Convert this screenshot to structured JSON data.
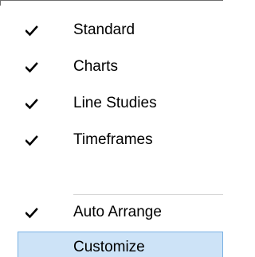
{
  "menu": {
    "items": [
      {
        "label": "Standard",
        "checked": true,
        "icon": "check-icon"
      },
      {
        "label": "Charts",
        "checked": true,
        "icon": "check-icon"
      },
      {
        "label": "Line Studies",
        "checked": true,
        "icon": "check-icon"
      },
      {
        "label": "Timeframes",
        "checked": true,
        "icon": "check-icon"
      },
      {
        "label": "Auto Arrange",
        "checked": true,
        "icon": "check-icon"
      },
      {
        "label": "Customize",
        "checked": false,
        "highlighted": true
      }
    ]
  },
  "colors": {
    "highlight_background": "#cde3f7",
    "highlight_border": "#7ab1e3",
    "separator": "#d7d7d7",
    "text": "#000000"
  }
}
